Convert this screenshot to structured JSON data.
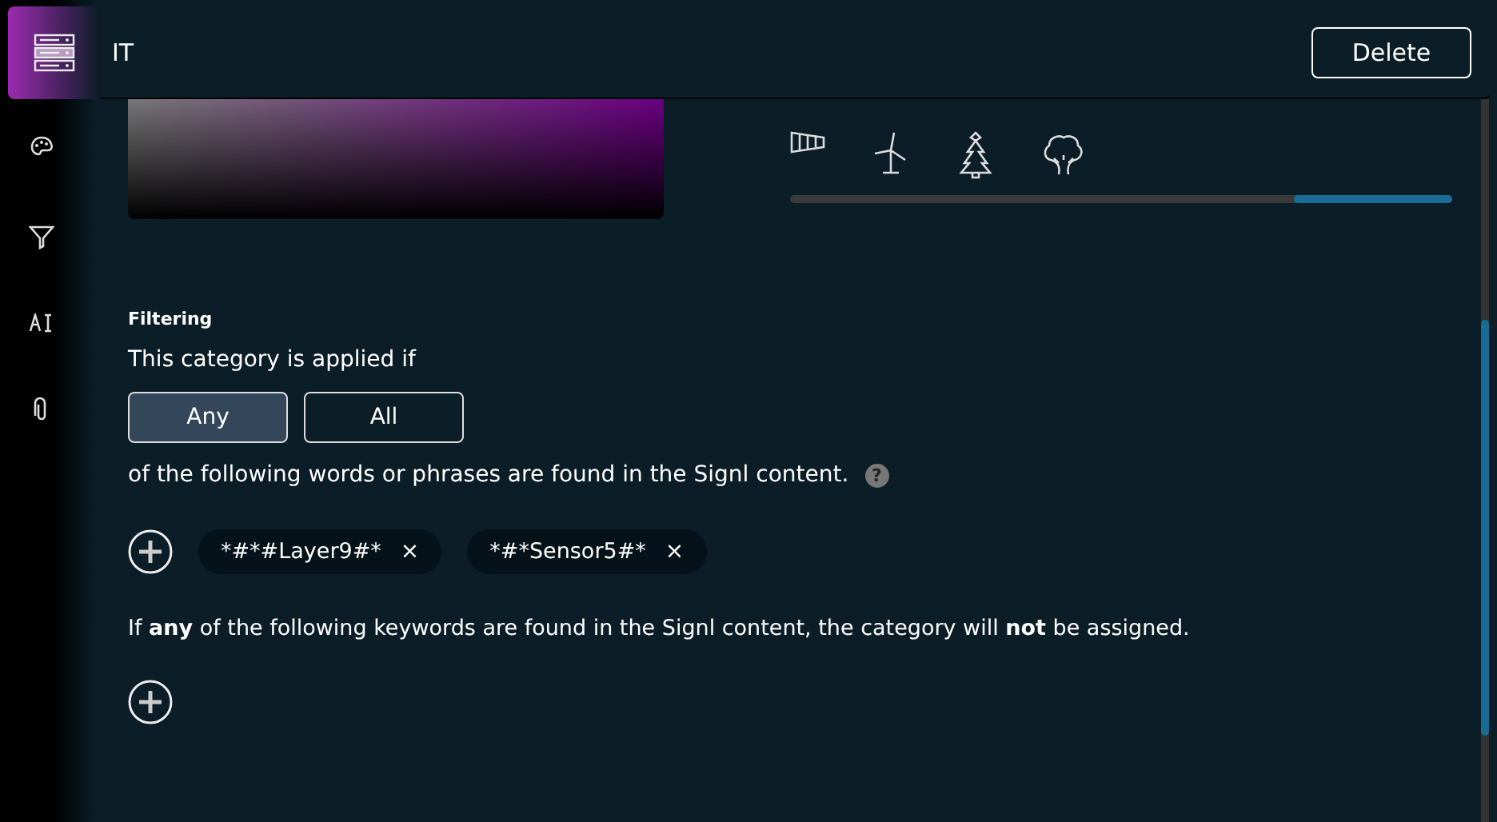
{
  "header": {
    "title": "IT",
    "delete_button": "Delete"
  },
  "filtering": {
    "heading": "Filtering",
    "intro": "This category is applied if",
    "match_modes": [
      {
        "label": "Any",
        "selected": true
      },
      {
        "label": "All",
        "selected": false
      }
    ],
    "description": "of the following words or phrases are found in the Signl content.",
    "help": "?",
    "include_keywords": [
      {
        "text": "*#*#Layer9#*",
        "remove": "×"
      },
      {
        "text": "*#*Sensor5#*",
        "remove": "×"
      }
    ],
    "exclude_text": "If **any** of the following keywords are found in the Signl content, the category will **not** be assigned."
  }
}
